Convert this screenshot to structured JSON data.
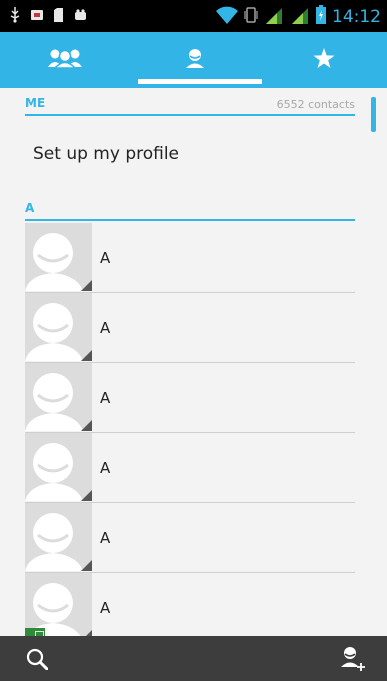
{
  "status_bar": {
    "time": "14:12",
    "icons": [
      "usb-icon",
      "notification-icon",
      "sd-card-icon",
      "android-icon",
      "wifi-icon",
      "vibrate-icon",
      "signal-icon",
      "signal-icon",
      "battery-icon"
    ],
    "accent_color": "#33b5e5"
  },
  "tabs": [
    {
      "name": "groups",
      "icon": "groups-icon"
    },
    {
      "name": "contacts",
      "icon": "person-icon",
      "selected": true
    },
    {
      "name": "favorites",
      "icon": "star-icon"
    }
  ],
  "me_section": {
    "title": "ME",
    "count": "6552 contacts",
    "profile_label": "Set up my profile"
  },
  "section_a": {
    "title": "A"
  },
  "contacts": [
    {
      "name": "A"
    },
    {
      "name": "A"
    },
    {
      "name": "A"
    },
    {
      "name": "A"
    },
    {
      "name": "A"
    },
    {
      "name": "A",
      "sim_badge": true
    }
  ],
  "bottom_bar": {
    "left_icon": "search-icon",
    "right_icon": "add-contact-icon"
  },
  "colors": {
    "tab_bar": "#32b4e6",
    "list_background": "#f3f3f3",
    "bottom_bar": "#3d3d3d"
  }
}
